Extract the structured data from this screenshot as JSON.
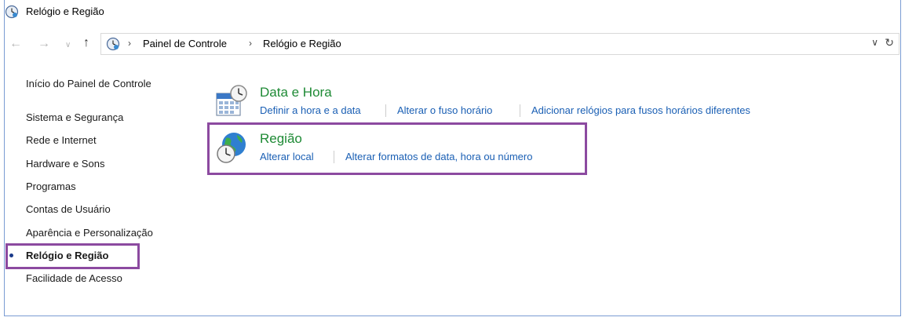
{
  "window": {
    "title": "Relógio e Região"
  },
  "address": {
    "breadcrumbs": [
      "Painel de Controle",
      "Relógio e Região"
    ]
  },
  "sidebar": {
    "home_label": "Início do Painel de Controle",
    "items": [
      {
        "label": "Sistema e Segurança"
      },
      {
        "label": "Rede e Internet"
      },
      {
        "label": "Hardware e Sons"
      },
      {
        "label": "Programas"
      },
      {
        "label": "Contas de Usuário"
      },
      {
        "label": "Aparência e Personalização"
      },
      {
        "label": "Relógio e Região",
        "current": true
      },
      {
        "label": "Facilidade de Acesso"
      }
    ]
  },
  "categories": [
    {
      "title": "Data e Hora",
      "icon": "calendar-clock-icon",
      "tasks": [
        "Definir a hora e a data",
        "Alterar o fuso horário",
        "Adicionar relógios para fusos horários diferentes"
      ]
    },
    {
      "title": "Região",
      "icon": "globe-clock-icon",
      "tasks": [
        "Alterar local",
        "Alterar formatos de data, hora ou número"
      ]
    }
  ],
  "colors": {
    "highlight": "#8c4aa0",
    "category_title": "#1e8a35",
    "link": "#1a5fb4"
  }
}
